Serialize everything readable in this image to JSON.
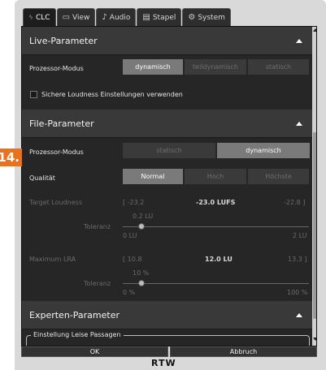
{
  "tabs": [
    {
      "label": "CLC",
      "icon": "clc-icon",
      "active": true
    },
    {
      "label": "View",
      "icon": "monitor-icon",
      "active": false
    },
    {
      "label": "Audio",
      "icon": "audio-icon",
      "active": false
    },
    {
      "label": "Stapel",
      "icon": "stack-icon",
      "active": false
    },
    {
      "label": "System",
      "icon": "gear-icon",
      "active": false
    }
  ],
  "live": {
    "title": "Live-Parameter",
    "processor_label": "Prozessor-Modus",
    "modes": [
      "dynamisch",
      "teildynamisch",
      "statisch"
    ],
    "selected_mode": "dynamisch",
    "safe_loudness_label": "Sichere Loudness Einstellungen verwenden",
    "safe_loudness_checked": false
  },
  "file": {
    "title": "File-Parameter",
    "processor_label": "Prozessor-Modus",
    "modes": [
      "statisch",
      "dynamisch"
    ],
    "selected_mode": "dynamisch",
    "quality_label": "Qualität",
    "qualities": [
      "Normal",
      "Hoch",
      "Höchste"
    ],
    "selected_quality": "Normal",
    "target": {
      "label": "Target Loudness",
      "min": "[ -23.2",
      "value": "-23.0 LUFS",
      "max": "-22.8 ]",
      "tolerance_label": "Toleranz",
      "tolerance_value": "0.2 LU",
      "slider_min": "0 LU",
      "slider_max": "2 LU",
      "slider_fraction": 0.1
    },
    "lra": {
      "label": "Maximum LRA",
      "min": "[ 10.8",
      "value": "12.0 LU",
      "max": "13.3 ]",
      "tolerance_label": "Toleranz",
      "tolerance_value": "10 %",
      "slider_min": "0 %",
      "slider_max": "100 %",
      "slider_fraction": 0.1
    }
  },
  "expert": {
    "title": "Experten-Parameter",
    "group_label": "Einstellung Leise Passagen"
  },
  "buttons": {
    "ok": "OK",
    "cancel": "Abbruch"
  },
  "logo": "RTW",
  "callout": "14."
}
